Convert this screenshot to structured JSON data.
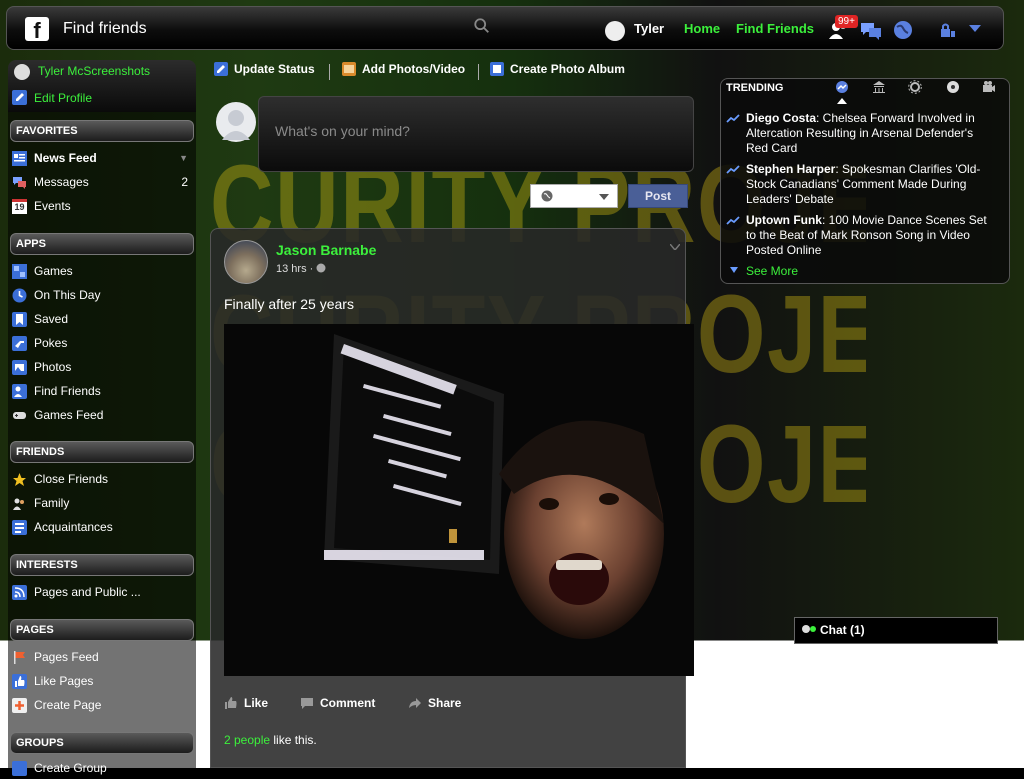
{
  "topbar": {
    "search_placeholder": "Find friends",
    "user_name": "Tyler",
    "home_label": "Home",
    "find_friends_label": "Find Friends",
    "friend_requests_badge": "99+",
    "icons": [
      "facebook-logo",
      "search-icon",
      "friend-requests-icon",
      "messages-icon",
      "notifications-globe-icon",
      "privacy-lock-icon",
      "chevron-down-icon"
    ]
  },
  "sidebar": {
    "profile_name": "Tyler McScreenshots",
    "edit_profile": "Edit Profile",
    "favorites": {
      "header": "FAVORITES",
      "items": [
        {
          "label": "News Feed",
          "icon": "news-feed-icon"
        },
        {
          "label": "Messages",
          "icon": "messages-icon",
          "count": "2"
        },
        {
          "label": "Events",
          "icon": "calendar-icon",
          "date": "19"
        }
      ]
    },
    "apps": {
      "header": "APPS",
      "items": [
        {
          "label": "Games",
          "icon": "games-icon"
        },
        {
          "label": "On This Day",
          "icon": "clock-icon"
        },
        {
          "label": "Saved",
          "icon": "bookmark-icon"
        },
        {
          "label": "Pokes",
          "icon": "poke-icon"
        },
        {
          "label": "Photos",
          "icon": "photos-icon"
        },
        {
          "label": "Find Friends",
          "icon": "find-friends-icon"
        },
        {
          "label": "Games Feed",
          "icon": "gamepad-icon"
        }
      ]
    },
    "friends": {
      "header": "FRIENDS",
      "items": [
        {
          "label": "Close Friends",
          "icon": "star-icon"
        },
        {
          "label": "Family",
          "icon": "family-icon"
        },
        {
          "label": "Acquaintances",
          "icon": "acquaintances-icon"
        }
      ]
    },
    "interests": {
      "header": "INTERESTS",
      "items": [
        {
          "label": "Pages and Public ...",
          "icon": "rss-icon"
        }
      ]
    },
    "pages": {
      "header": "PAGES",
      "items": [
        {
          "label": "Pages Feed",
          "icon": "flag-icon"
        },
        {
          "label": "Like Pages",
          "icon": "thumbs-up-icon"
        },
        {
          "label": "Create Page",
          "icon": "create-page-icon"
        }
      ]
    },
    "groups": {
      "header": "GROUPS",
      "items": [
        {
          "label": "Create Group",
          "icon": "group-icon"
        }
      ]
    }
  },
  "composer": {
    "tabs": [
      "Update Status",
      "Add Photos/Video",
      "Create Photo Album"
    ],
    "placeholder": "What's on your mind?",
    "post_label": "Post"
  },
  "post": {
    "author": "Jason Barnabe",
    "time": "13 hrs ·",
    "text": "Finally after 25 years",
    "actions": [
      "Like",
      "Comment",
      "Share"
    ],
    "likes_link": "2 people",
    "likes_suffix": " like this."
  },
  "trending": {
    "title": "TRENDING",
    "items": [
      {
        "name": "Diego Costa",
        "text": ": Chelsea Forward Involved in Altercation Resulting in Arsenal Defender's Red Card"
      },
      {
        "name": "Stephen Harper",
        "text": ": Spokesman Clarifies 'Old-Stock Canadians' Comment Made During Leaders' Debate"
      },
      {
        "name": "Uptown Funk",
        "text": ": 100 Movie Dance Scenes Set to the Beat of Mark Ronson Song in Video Posted Online"
      }
    ],
    "see_more": "See More"
  },
  "chat": {
    "label": "Chat (1)"
  },
  "colors": {
    "accent_green": "#3cf03c",
    "badge_red": "#e02424",
    "post_button": "#4a5f97"
  }
}
